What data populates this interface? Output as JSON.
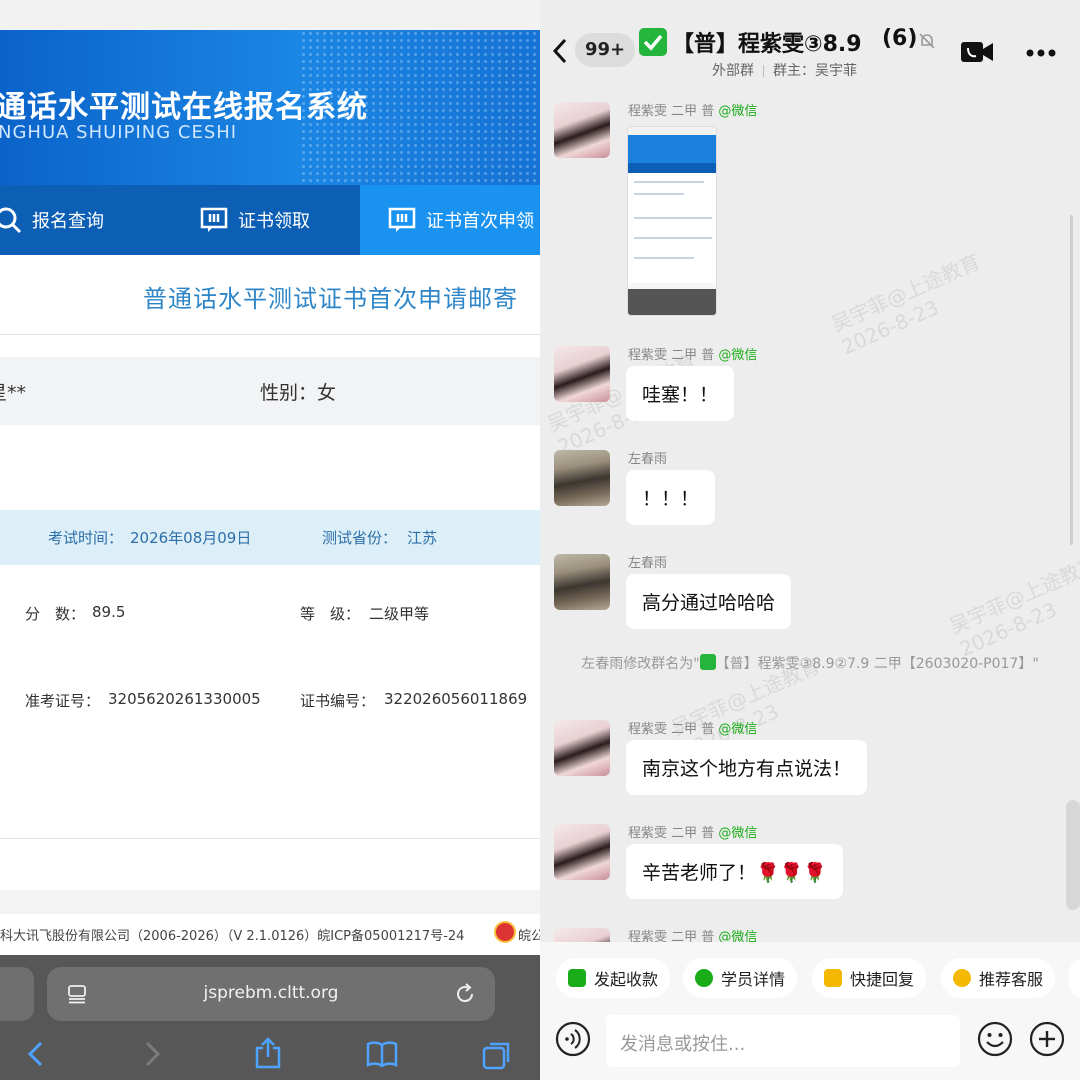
{
  "left": {
    "banner": {
      "title": "通话水平测试在线报名系统",
      "subtitle": "NGHUA SHUIPING CESHI"
    },
    "nav": [
      "报名查询",
      "证书领取",
      "证书首次申领"
    ],
    "page_title": "普通话水平测试证书首次申请邮寄",
    "name_partial": "星**",
    "gender": "性别：女",
    "exam_time_label": "考试时间：",
    "exam_time_value": "2026年08月09日",
    "province_label": "测试省份：",
    "province_value": "江苏",
    "score_label": "分　数：",
    "score_value": "89.5",
    "level_label": "等　级：",
    "level_value": "二级甲等",
    "ticket_label": "准考证号：",
    "ticket_value": "3205620261330005",
    "cert_label": "证书编号：",
    "cert_value": "322026056011869",
    "footer": "科大讯飞股份有限公司（2006-2026）（V 2.1.0126）皖ICP备05001217号-24",
    "footer_tail": "皖公",
    "url": "jsprebm.cltt.org"
  },
  "right": {
    "back_badge": "99+",
    "group_name": "【普】程紫雯③8.9",
    "group_count": "(6)",
    "group_type": "外部群",
    "group_owner": "群主：吴宇菲",
    "messages": [
      {
        "sender": "程紫雯 二甲 普",
        "source": "@微信",
        "text": ""
      },
      {
        "sender": "程紫雯 二甲 普",
        "source": "@微信",
        "text": "哇塞！！"
      },
      {
        "sender": "左春雨",
        "source": "",
        "text": "！！！"
      },
      {
        "sender": "左春雨",
        "source": "",
        "text": "高分通过哈哈哈"
      },
      {
        "sender": "程紫雯 二甲 普",
        "source": "@微信",
        "text": "南京这个地方有点说法！"
      },
      {
        "sender": "程紫雯 二甲 普",
        "source": "@微信",
        "text": "辛苦老师了！🌹🌹🌹"
      },
      {
        "sender": "程紫雯 二甲 普",
        "source": "@微信",
        "text": ""
      }
    ],
    "system_msg_a": "左春雨修改群名为\"",
    "system_msg_b": "【普】程紫雯③8.9②7.9 二甲【2603020-P017】\"",
    "watermark_name": "吴宇菲@上途教育",
    "watermark_date": "2026-8-23",
    "quick_actions": [
      "发起收款",
      "学员详情",
      "快捷回复",
      "推荐客服"
    ],
    "input_placeholder": "发消息或按住...",
    "colors": {
      "green": "#25b53c",
      "wechat_green": "#1aad19",
      "chip_yellow": "#f5b800"
    }
  }
}
